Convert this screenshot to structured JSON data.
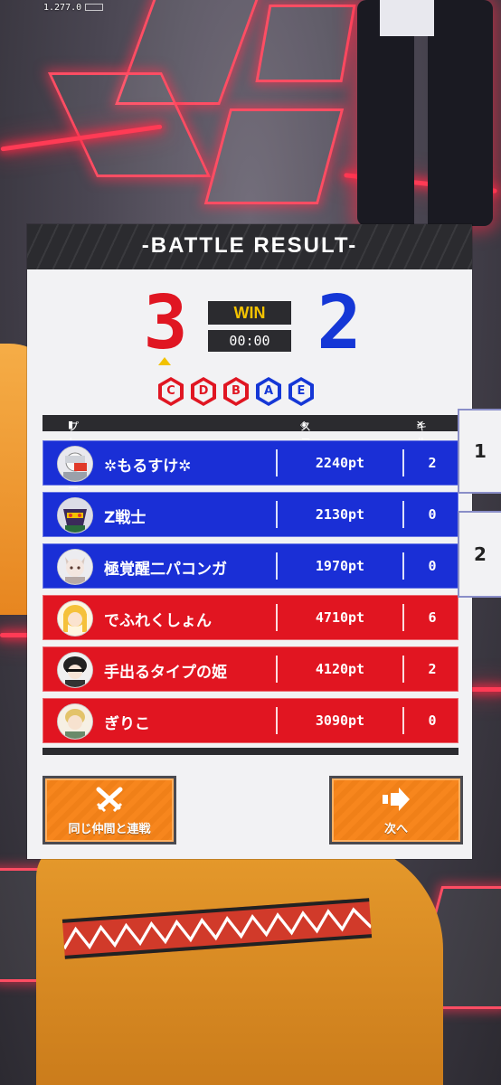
{
  "version": "1.277.0",
  "title": "-BATTLE RESULT-",
  "score": {
    "red": "3",
    "blue": "2"
  },
  "result": "WIN",
  "timer": "00:00",
  "zones": [
    {
      "label": "C",
      "team": "red"
    },
    {
      "label": "D",
      "team": "red"
    },
    {
      "label": "B",
      "team": "red"
    },
    {
      "label": "A",
      "team": "blue"
    },
    {
      "label": "E",
      "team": "blue"
    }
  ],
  "table": {
    "headers": {
      "player": "プレイヤー名",
      "score": "スコア",
      "kill": "キル"
    },
    "rows": [
      {
        "name": "✲もるすけ✲",
        "score": "2240pt",
        "kills": "2",
        "team": "blue"
      },
      {
        "name": "Z戦士",
        "score": "2130pt",
        "kills": "0",
        "team": "blue"
      },
      {
        "name": "極覚醒二パコンガ",
        "score": "1970pt",
        "kills": "0",
        "team": "blue"
      },
      {
        "name": "でふれくしょん",
        "score": "4710pt",
        "kills": "6",
        "team": "red"
      },
      {
        "name": "手出るタイプの姫",
        "score": "4120pt",
        "kills": "2",
        "team": "red"
      },
      {
        "name": "ぎりこ",
        "score": "3090pt",
        "kills": "0",
        "team": "red"
      }
    ]
  },
  "parties": [
    "1",
    "2"
  ],
  "buttons": {
    "rematch": "同じ仲間と連戦",
    "next": "次へ"
  },
  "colors": {
    "red_team": "#e11521",
    "blue_team": "#1a2fd6",
    "accent": "#f7861d",
    "win": "#f4c300"
  }
}
